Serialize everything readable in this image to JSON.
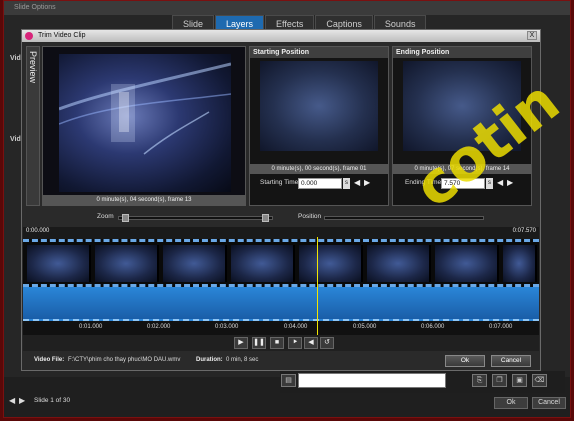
{
  "parent_window": {
    "title": "Slide Options",
    "tabs": [
      "Slide",
      "Layers",
      "Effects",
      "Captions",
      "Sounds"
    ],
    "active_tab": "Layers",
    "side_labels": [
      "Vid",
      "Vid"
    ],
    "footer_slide_info": "Slide 1 of 30",
    "ok_label": "Ok",
    "cancel_label": "Cancel"
  },
  "dialog": {
    "title": "Trim Video Clip",
    "close_label": "X",
    "preview": {
      "tab_label": "Preview",
      "caption": "0 minute(s), 04 second(s), frame 13"
    },
    "starting_position": {
      "header": "Starting Position",
      "caption": "0 minute(s), 00 second(s), frame 01",
      "label": "Starting Time",
      "value": "0.000",
      "unit": "s"
    },
    "ending_position": {
      "header": "Ending Position",
      "caption": "0 minute(s), 07 second(s), frame 14",
      "label": "Ending Time",
      "value": "7.570",
      "unit": "s"
    },
    "zoom_label": "Zoom",
    "position_label": "Position",
    "timeline": {
      "start_label": "0:00.000",
      "end_label": "0:07.570",
      "ruler": [
        "0:01.000",
        "0:02.000",
        "0:03.000",
        "0:04.000",
        "0:05.000",
        "0:06.000",
        "0:07.000"
      ],
      "playhead_fraction": 0.57
    },
    "controls": {
      "play": "▶",
      "pause": "❚❚",
      "stop": "■",
      "mark_start": "⯈",
      "mark_end": "◀",
      "loop": "↺"
    },
    "video_file_label": "Video File:",
    "video_file_value": "F:\\CTY\\phim cho thay phuc\\MO DAU.wmv",
    "duration_label": "Duration:",
    "duration_value": "0 min, 8 sec",
    "ok_label": "Ok",
    "cancel_label": "Cancel"
  },
  "watermark": "cotin"
}
